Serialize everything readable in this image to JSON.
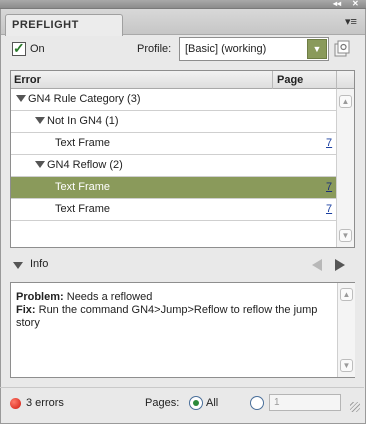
{
  "window": {
    "collapse_glyph": "◂◂",
    "close_glyph": "✕"
  },
  "panel": {
    "tab_label": "PREFLIGHT",
    "menu_icon": "panel-menu-icon"
  },
  "on_toggle": {
    "label": "On",
    "checked": true
  },
  "profile": {
    "label": "Profile:",
    "value": "[Basic] (working)"
  },
  "table": {
    "headers": {
      "error": "Error",
      "page": "Page"
    },
    "rows": [
      {
        "label": "GN4 Rule Category (3)",
        "level": 0,
        "expanded": true,
        "page": "",
        "selected": false
      },
      {
        "label": "Not In GN4 (1)",
        "level": 1,
        "expanded": true,
        "page": "",
        "selected": false
      },
      {
        "label": "Text Frame",
        "level": 2,
        "expanded": false,
        "page": "7",
        "selected": false
      },
      {
        "label": "GN4 Reflow (2)",
        "level": 1,
        "expanded": true,
        "page": "",
        "selected": false
      },
      {
        "label": "Text Frame",
        "level": 2,
        "expanded": false,
        "page": "7",
        "selected": true
      },
      {
        "label": "Text Frame",
        "level": 2,
        "expanded": false,
        "page": "7",
        "selected": false
      }
    ]
  },
  "info": {
    "label": "Info",
    "problem_key": "Problem:",
    "problem_value": "Needs a reflowed",
    "fix_key": "Fix:",
    "fix_value": "Run the command GN4>Jump>Reflow to reflow the jump story"
  },
  "status": {
    "errors": "3 errors",
    "pages_label": "Pages:",
    "all_label": "All",
    "range_placeholder": "1"
  },
  "colors": {
    "selection": "#8a9a5b",
    "error_dot": "#d01a10",
    "link": "#1a3fa0"
  }
}
